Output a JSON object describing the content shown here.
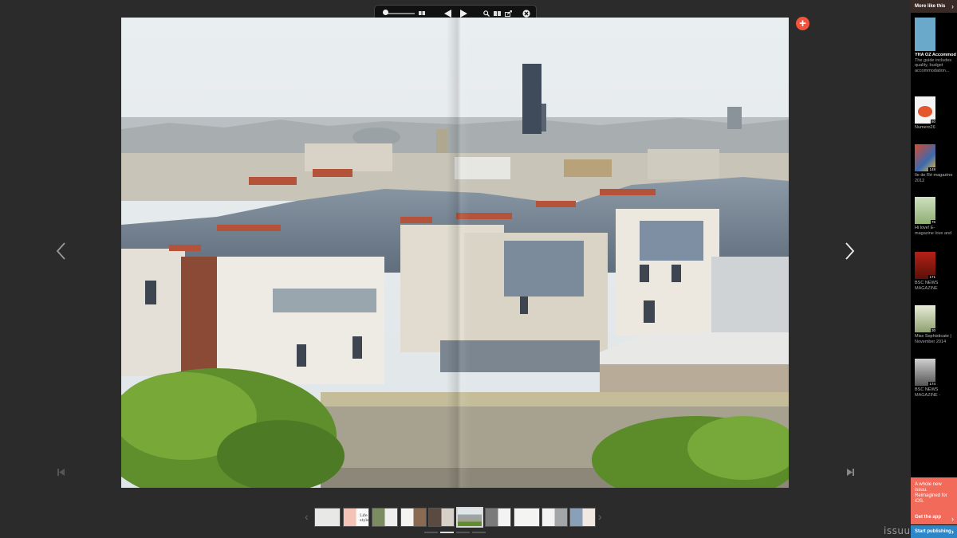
{
  "toolbar": {
    "zoom_level": 0.1,
    "icons": [
      "zoom-slider",
      "spread-view-icon",
      "prev-page-icon",
      "next-page-icon",
      "search-icon",
      "thumbnails-icon",
      "share-icon",
      "close-icon"
    ]
  },
  "colors": {
    "background": "#2b2b2b",
    "sidebar": "#000000",
    "accent_orange": "#f0543c",
    "promo": "#f26a5a",
    "publish": "#2d86c8"
  },
  "sidebar": {
    "header": "More like this",
    "items": [
      {
        "title": "YHA OZ AccommodationGui",
        "description": [
          "The guide includes",
          "quality, budget",
          "accommodation..."
        ],
        "count": "",
        "tag": "",
        "cover_color": "#6aa9c9"
      },
      {
        "title": "Numero26",
        "description": [],
        "count": "80",
        "tag": "",
        "cover_color": "#f4f4f4"
      },
      {
        "title": "Ile de Ré magazine",
        "description": [
          "2012"
        ],
        "count": "148",
        "tag": "",
        "cover_color": "#d94a2e"
      },
      {
        "title": "Hi love! E-",
        "description": [
          "magazine love and"
        ],
        "count": "76",
        "tag": "",
        "cover_color": "#8fae74"
      },
      {
        "title": "BSC NEWS",
        "description": [
          "MAGAZINE"
        ],
        "count": "171",
        "tag": "",
        "cover_color": "#b52118"
      },
      {
        "title": "Miss Sophisticate |",
        "description": [
          "November 2014"
        ],
        "count": "30",
        "tag": "",
        "cover_color": "#b8c2a0"
      },
      {
        "title": "BSC NEWS",
        "description": [
          "MAGAZINE -"
        ],
        "count": "174",
        "tag": "",
        "cover_color": "#8a8a8a"
      }
    ]
  },
  "promo": {
    "lines": [
      "A whole new",
      "issuu.",
      "Reimagined for",
      "iOS."
    ],
    "cta": "Get the app"
  },
  "publish": {
    "label": "Start publishing"
  },
  "brand": {
    "logo": "issuu"
  },
  "thumbnails": {
    "count": 12,
    "active_index": 5,
    "pager_count": 4,
    "pager_active": 1,
    "labels": [
      "",
      "Life style",
      "",
      "",
      "",
      "",
      "",
      "",
      "",
      "",
      "",
      ""
    ]
  }
}
